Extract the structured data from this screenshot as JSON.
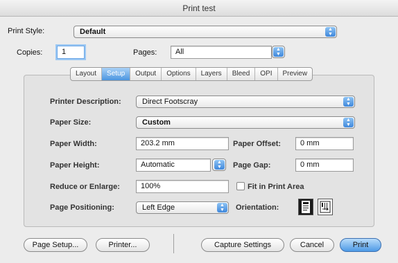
{
  "window": {
    "title": "Print test"
  },
  "print_style": {
    "label": "Print Style:",
    "value": "Default"
  },
  "copies": {
    "label": "Copies:",
    "value": "1"
  },
  "pages": {
    "label": "Pages:",
    "value": "All"
  },
  "tabs": [
    {
      "label": "Layout",
      "active": false
    },
    {
      "label": "Setup",
      "active": true
    },
    {
      "label": "Output",
      "active": false
    },
    {
      "label": "Options",
      "active": false
    },
    {
      "label": "Layers",
      "active": false
    },
    {
      "label": "Bleed",
      "active": false
    },
    {
      "label": "OPI",
      "active": false
    },
    {
      "label": "Preview",
      "active": false
    }
  ],
  "setup": {
    "printer_description": {
      "label": "Printer Description:",
      "value": "Direct Footscray"
    },
    "paper_size": {
      "label": "Paper Size:",
      "value": "Custom"
    },
    "paper_width": {
      "label": "Paper Width:",
      "value": "203.2 mm"
    },
    "paper_offset": {
      "label": "Paper Offset:",
      "value": "0 mm"
    },
    "paper_height": {
      "label": "Paper Height:",
      "value": "Automatic"
    },
    "page_gap": {
      "label": "Page Gap:",
      "value": "0 mm"
    },
    "reduce_enlarge": {
      "label": "Reduce or Enlarge:",
      "value": "100%"
    },
    "fit_in_print_area": {
      "label": "Fit in Print Area",
      "checked": false
    },
    "page_positioning": {
      "label": "Page Positioning:",
      "value": "Left Edge"
    },
    "orientation": {
      "label": "Orientation:",
      "selected": "portrait"
    }
  },
  "buttons": {
    "page_setup": "Page Setup...",
    "printer": "Printer...",
    "capture_settings": "Capture Settings",
    "cancel": "Cancel",
    "print": "Print"
  },
  "colors": {
    "accent": "#4b95e0",
    "panel": "#e3e3e3"
  }
}
